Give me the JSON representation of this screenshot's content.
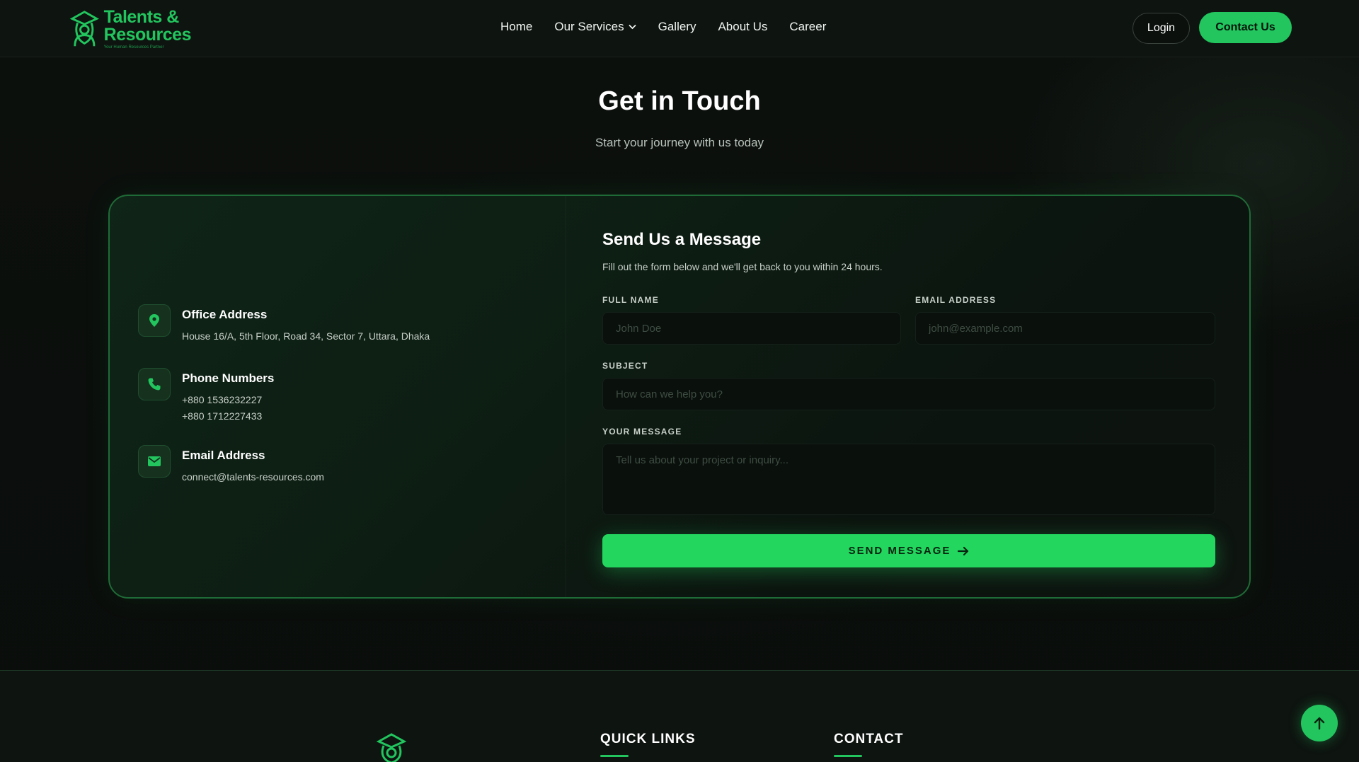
{
  "brand": {
    "line1": "Talents &",
    "line2": "Resources",
    "tagline": "Your Human Resources Partner",
    "accent": "#22c55e"
  },
  "nav": {
    "items": [
      "Home",
      "Our Services",
      "Gallery",
      "About Us",
      "Career"
    ],
    "login": "Login",
    "contact": "Contact Us"
  },
  "hero": {
    "title": "Get in Touch",
    "subtitle": "Start your journey with us today"
  },
  "contact_info": [
    {
      "title": "Office Address",
      "lines": [
        "House 16/A, 5th Floor, Road 34, Sector 7, Uttara, Dhaka"
      ],
      "icon": "map-pin-icon"
    },
    {
      "title": "Phone Numbers",
      "lines": [
        "+880 1536232227",
        "+880 1712227433"
      ],
      "icon": "phone-icon"
    },
    {
      "title": "Email Address",
      "lines": [
        "connect@talents-resources.com"
      ],
      "icon": "envelope-icon"
    }
  ],
  "form": {
    "title": "Send Us a Message",
    "description": "Fill out the form below and we'll get back to you within 24 hours.",
    "full_name_label": "FULL NAME",
    "full_name_placeholder": "John Doe",
    "email_label": "EMAIL ADDRESS",
    "email_placeholder": "john@example.com",
    "subject_label": "SUBJECT",
    "subject_placeholder": "How can we help you?",
    "message_label": "YOUR MESSAGE",
    "message_placeholder": "Tell us about your project or inquiry...",
    "submit": "SEND MESSAGE"
  },
  "footer": {
    "quick_links": "QUICK LINKS",
    "contact": "CONTACT"
  }
}
